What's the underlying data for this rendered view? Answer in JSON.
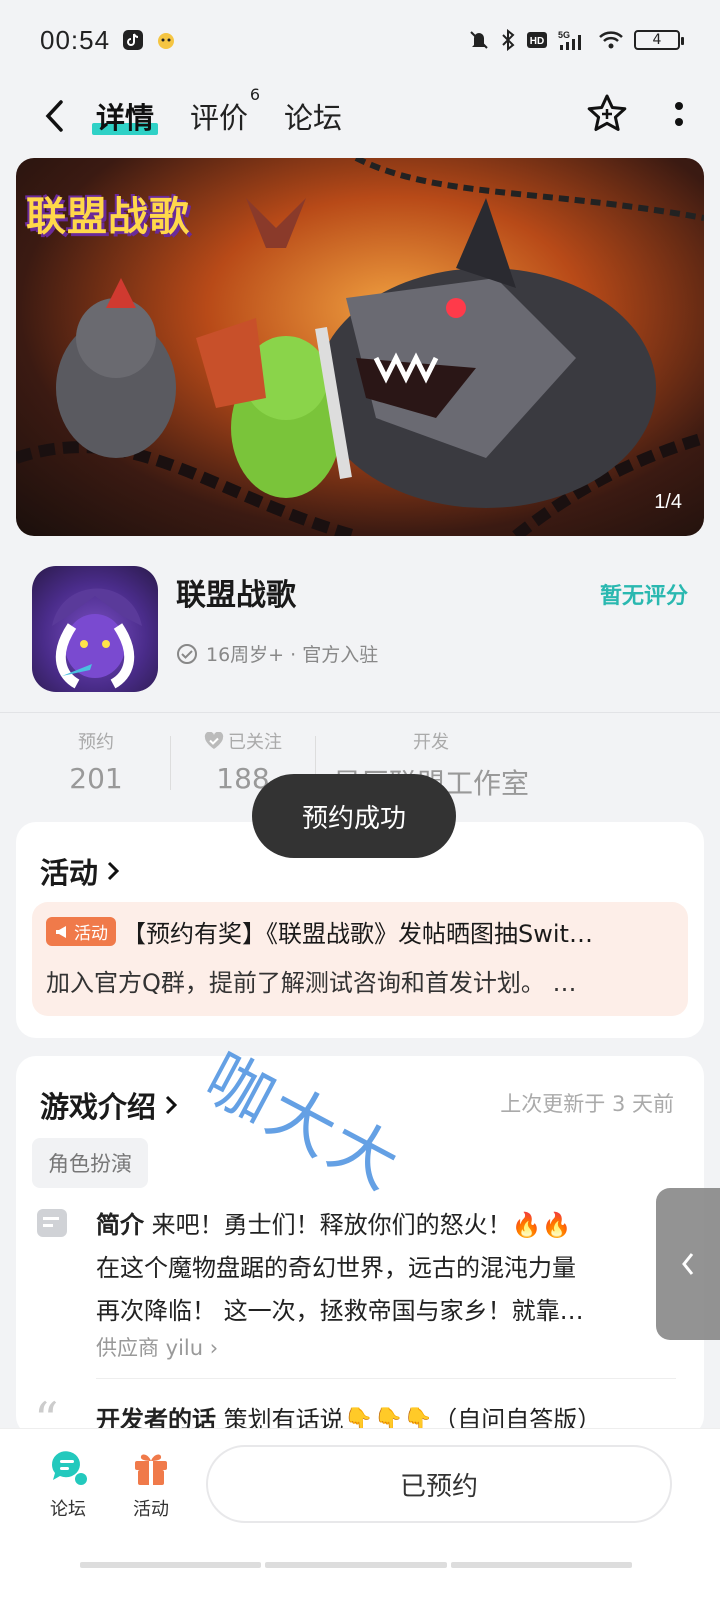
{
  "status_bar": {
    "time": "00:54",
    "battery": "4",
    "network": "5G"
  },
  "nav": {
    "tabs": [
      {
        "label": "详情"
      },
      {
        "label": "评价",
        "badge": "6"
      },
      {
        "label": "论坛"
      }
    ]
  },
  "banner": {
    "logo_text": "联盟战歌",
    "counter": "1/4"
  },
  "app": {
    "name": "联盟战歌",
    "tags": "16周岁+ · 官方入驻",
    "rating": "暂无评分"
  },
  "stats": {
    "reserve_label": "预约",
    "reserve_value": "201",
    "follow_label": "已关注",
    "follow_value": "188",
    "dev_label": "开发",
    "dev_value": "星辰联盟工作室"
  },
  "toast": "预约成功",
  "activity": {
    "title": "活动",
    "badge": "活动",
    "headline": "【预约有奖】《联盟战歌》发帖晒图抽Swit…",
    "subline": "加入官方Q群，提前了解测试咨询和首发计划。 …"
  },
  "intro": {
    "title": "游戏介绍",
    "updated": "上次更新于 3 天前",
    "genre": "角色扮演",
    "label": "简介",
    "line1": "来吧！勇士们！释放你们的怒火！🔥🔥",
    "line2": "在这个魔物盘踞的奇幻世界，远古的混沌力量",
    "line3": "再次降临！ 这一次，拯救帝国与家乡！就靠…",
    "supplier": "供应商 yilu",
    "dev_words_label": "开发者的话",
    "dev_words": "策划有话说👇👇👇（自问自答版）"
  },
  "watermark": "咖大大",
  "bottom_bar": {
    "forum": "论坛",
    "activity": "活动",
    "reserve_button": "已预约"
  },
  "colors": {
    "accent": "#2fd1c6",
    "rating": "#2ab8b0",
    "activity_badge": "#f07a4a"
  }
}
